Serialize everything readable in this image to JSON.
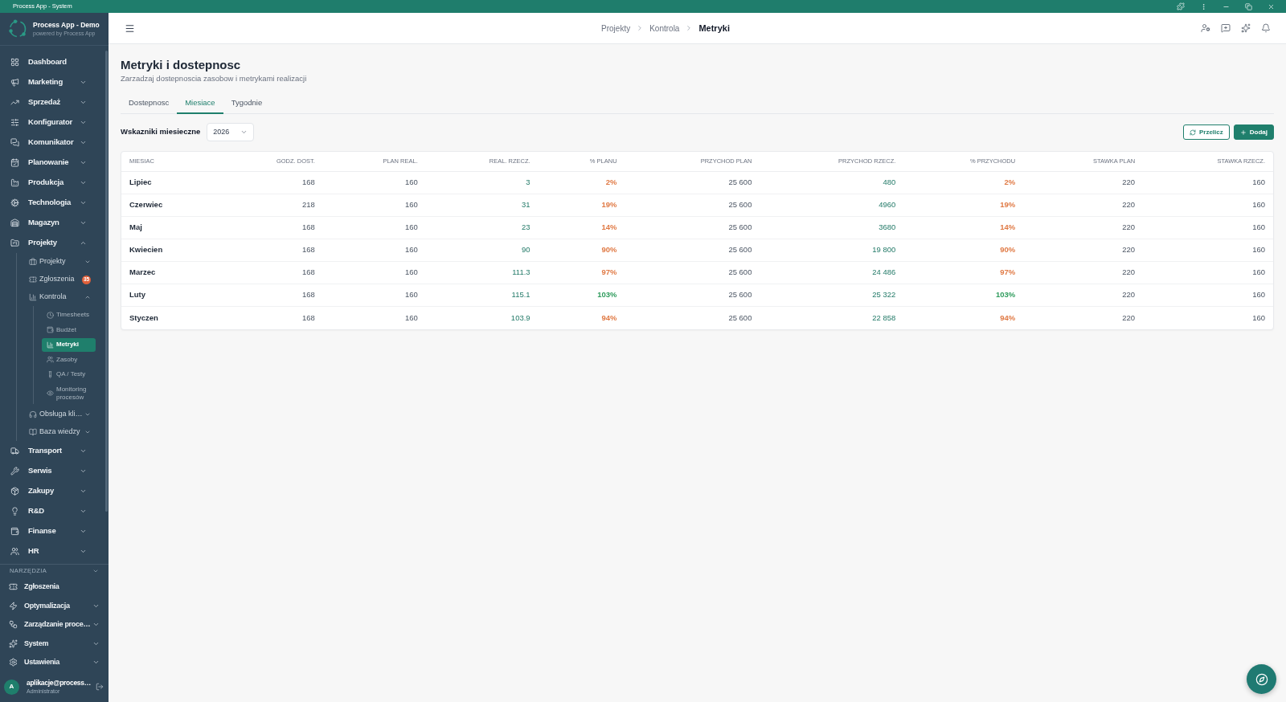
{
  "window": {
    "title": "Process App - System"
  },
  "sidebar": {
    "app_name": "Process App - Demo",
    "app_tagline": "powered by Process App",
    "items": [
      {
        "label": "Dashboard",
        "selected": false
      },
      {
        "label": "Marketing",
        "expanded": false,
        "selected": false
      },
      {
        "label": "Sprzedaż",
        "expanded": false,
        "selected": false
      },
      {
        "label": "Konfigurator",
        "expanded": false,
        "selected": false
      },
      {
        "label": "Komunikator",
        "expanded": false,
        "selected": false
      },
      {
        "label": "Planowanie",
        "expanded": false,
        "selected": false
      },
      {
        "label": "Produkcja",
        "expanded": false,
        "selected": false
      },
      {
        "label": "Technologia",
        "expanded": false,
        "selected": false
      },
      {
        "label": "Magazyn",
        "expanded": false,
        "selected": false
      },
      {
        "label": "Projekty",
        "expanded": true,
        "selected": false,
        "children": [
          {
            "label": "Projekty",
            "expanded": false,
            "selected": false
          },
          {
            "label": "Zgłoszenia",
            "badge": "35",
            "selected": false
          },
          {
            "label": "Kontrola",
            "expanded": true,
            "selected": false,
            "children": [
              {
                "label": "Timesheets",
                "selected": false
              },
              {
                "label": "Budżet",
                "selected": false
              },
              {
                "label": "Metryki",
                "selected": true
              },
              {
                "label": "Zasoby",
                "selected": false
              },
              {
                "label": "QA / Testy",
                "selected": false
              },
              {
                "label": "Monitoring procesów",
                "selected": false
              }
            ]
          },
          {
            "label": "Obsługa kli…",
            "expanded": false,
            "selected": false
          },
          {
            "label": "Baza wiedzy",
            "expanded": false,
            "selected": false
          }
        ]
      },
      {
        "label": "Transport",
        "expanded": false,
        "selected": false
      },
      {
        "label": "Serwis",
        "expanded": false,
        "selected": false
      },
      {
        "label": "Zakupy",
        "expanded": false,
        "selected": false
      },
      {
        "label": "R&D",
        "expanded": false,
        "selected": false
      },
      {
        "label": "Finanse",
        "expanded": false,
        "selected": false
      },
      {
        "label": "HR",
        "expanded": false,
        "selected": false
      }
    ],
    "tools": {
      "title": "NARZĘDZIA",
      "items": [
        {
          "label": "Zgłoszenia",
          "selected": false
        },
        {
          "label": "Optymalizacja",
          "expanded": false,
          "selected": false
        },
        {
          "label": "Zarządzanie proce…",
          "expanded": false,
          "selected": false
        },
        {
          "label": "System",
          "expanded": false,
          "selected": false
        },
        {
          "label": "Ustawienia",
          "expanded": false,
          "selected": false
        }
      ]
    },
    "user": {
      "avatar": "A",
      "name": "aplikacje@process…",
      "role": "Administrator"
    }
  },
  "header": {
    "breadcrumbs": [
      {
        "label": "Projekty",
        "current": false
      },
      {
        "label": "Kontrola",
        "current": false
      },
      {
        "label": "Metryki",
        "current": true
      }
    ]
  },
  "page": {
    "title": "Metryki i dostepnosc",
    "subtitle": "Zarzadzaj dostepnoscia zasobow i metrykami realizacji",
    "tabs": [
      {
        "label": "Dostepnosc",
        "selected": false
      },
      {
        "label": "Miesiace",
        "selected": true
      },
      {
        "label": "Tygodnie",
        "selected": false
      }
    ],
    "toolbar": {
      "label": "Wskazniki miesieczne",
      "year": {
        "value": "2026"
      },
      "buttons": [
        {
          "label": "Przelicz",
          "kind": "outline"
        },
        {
          "label": "Dodaj",
          "kind": "primary"
        }
      ]
    },
    "table": {
      "columns": [
        {
          "label": "MIESIAC",
          "kind": "label"
        },
        {
          "label": "GODZ. DOST.",
          "kind": "number"
        },
        {
          "label": "PLAN REAL.",
          "kind": "number"
        },
        {
          "label": "REAL. RZECZ.",
          "kind": "actual"
        },
        {
          "label": "% PLANU",
          "kind": "percent"
        },
        {
          "label": "PRZYCHOD PLAN",
          "kind": "number"
        },
        {
          "label": "PRZYCHOD RZECZ.",
          "kind": "actual"
        },
        {
          "label": "% PRZYCHODU",
          "kind": "percent"
        },
        {
          "label": "STAWKA PLAN",
          "kind": "number"
        },
        {
          "label": "STAWKA RZECZ.",
          "kind": "number"
        }
      ],
      "rows": [
        {
          "cells": [
            "Lipiec",
            "168",
            "160",
            "3",
            {
              "text": "2%",
              "color": "#e07a45"
            },
            "25 600",
            "480",
            {
              "text": "2%",
              "color": "#e07a45"
            },
            "220",
            "160"
          ]
        },
        {
          "cells": [
            "Czerwiec",
            "218",
            "160",
            "31",
            {
              "text": "19%",
              "color": "#e07a45"
            },
            "25 600",
            "4960",
            {
              "text": "19%",
              "color": "#e07a45"
            },
            "220",
            "160"
          ]
        },
        {
          "cells": [
            "Maj",
            "168",
            "160",
            "23",
            {
              "text": "14%",
              "color": "#e07a45"
            },
            "25 600",
            "3680",
            {
              "text": "14%",
              "color": "#e07a45"
            },
            "220",
            "160"
          ]
        },
        {
          "cells": [
            "Kwiecien",
            "168",
            "160",
            "90",
            {
              "text": "90%",
              "color": "#e07a45"
            },
            "25 600",
            "19 800",
            {
              "text": "90%",
              "color": "#e07a45"
            },
            "220",
            "160"
          ]
        },
        {
          "cells": [
            "Marzec",
            "168",
            "160",
            "111.3",
            {
              "text": "97%",
              "color": "#e07a45"
            },
            "25 600",
            "24 486",
            {
              "text": "97%",
              "color": "#e07a45"
            },
            "220",
            "160"
          ]
        },
        {
          "cells": [
            "Luty",
            "168",
            "160",
            "115.1",
            {
              "text": "103%",
              "color": "#2e9b5c"
            },
            "25 600",
            "25 322",
            {
              "text": "103%",
              "color": "#2e9b5c"
            },
            "220",
            "160"
          ]
        },
        {
          "cells": [
            "Styczen",
            "168",
            "160",
            "103.9",
            {
              "text": "94%",
              "color": "#e07a45"
            },
            "25 600",
            "22 858",
            {
              "text": "94%",
              "color": "#e07a45"
            },
            "220",
            "160"
          ]
        }
      ]
    }
  }
}
